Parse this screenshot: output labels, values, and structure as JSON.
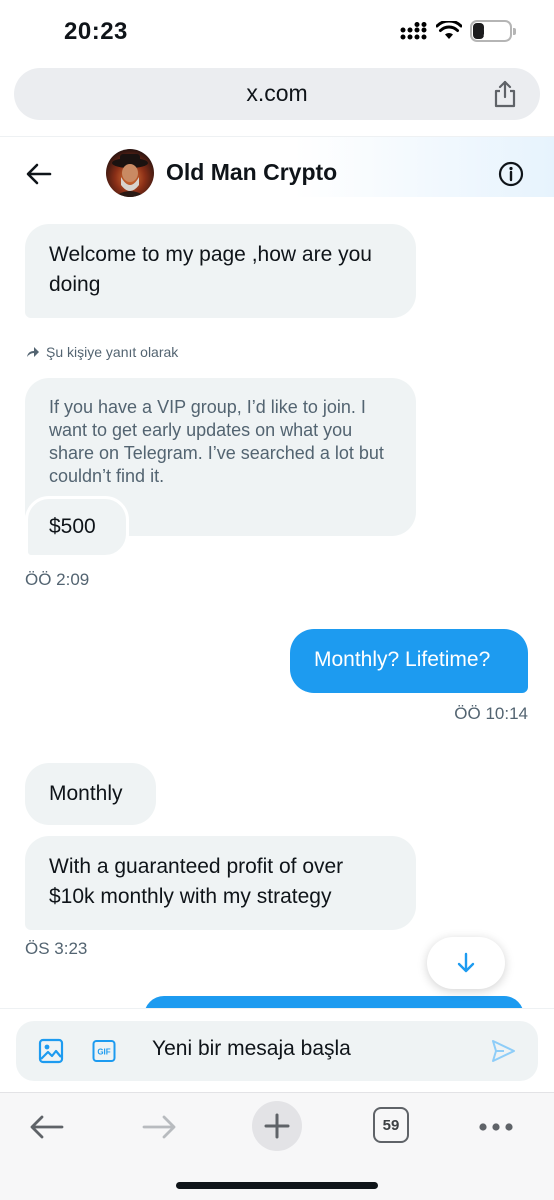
{
  "status_bar": {
    "time": "20:23",
    "battery": "27"
  },
  "browser": {
    "url": "x.com",
    "tabs_count": "59"
  },
  "header": {
    "contact_name": "Old Man Crypto"
  },
  "messages": {
    "m1": {
      "text": "Welcome to my page ,how are you doing"
    },
    "reply_label": "Şu kişiye yanıt olarak",
    "quoted_text": "If you have a VIP group, I’d like to join. I want to get early updates on what you share on Telegram. I’ve searched a lot but couldn’t find it.",
    "m2": {
      "text": "$500"
    },
    "ts1": "ÖÖ 2:09",
    "m3": {
      "text": "Monthly? Lifetime?"
    },
    "ts2": "ÖÖ 10:14",
    "m4": {
      "text": "Monthly"
    },
    "m5": {
      "text": "With a guaranteed profit of over $10k monthly with my strategy"
    },
    "ts3": "ÖS 3:23"
  },
  "composer": {
    "placeholder": "Yeni bir mesaja başla"
  },
  "colors": {
    "accent": "#1d9bf0",
    "received_bubble": "#eff3f4",
    "secondary_text": "#536471"
  },
  "icons": [
    "back-arrow-icon",
    "info-icon",
    "share-icon",
    "reply-arrow-icon",
    "chevron-down-icon",
    "media-icon",
    "gif-icon",
    "send-icon",
    "browser-back-icon",
    "browser-forward-icon",
    "new-tab-icon",
    "more-icon"
  ]
}
